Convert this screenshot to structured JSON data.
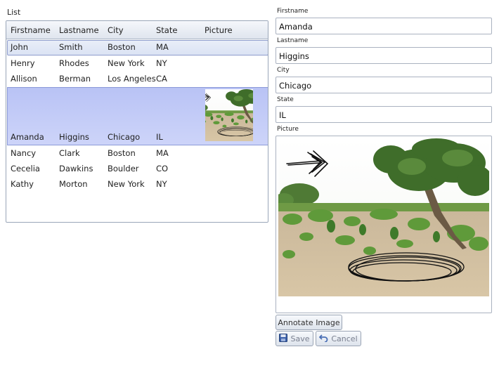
{
  "list": {
    "title": "List",
    "columns": [
      "Firstname",
      "Lastname",
      "City",
      "State",
      "Picture"
    ],
    "rows": [
      {
        "firstname": "John",
        "lastname": "Smith",
        "city": "Boston",
        "state": "MA"
      },
      {
        "firstname": "Henry",
        "lastname": "Rhodes",
        "city": "New York",
        "state": "NY"
      },
      {
        "firstname": "Allison",
        "lastname": "Berman",
        "city": "Los Angeles",
        "state": "CA"
      },
      {
        "firstname": "Amanda",
        "lastname": "Higgins",
        "city": "Chicago",
        "state": "IL"
      },
      {
        "firstname": "Nancy",
        "lastname": "Clark",
        "city": "Boston",
        "state": "MA"
      },
      {
        "firstname": "Cecelia",
        "lastname": "Dawkins",
        "city": "Boulder",
        "state": "CO"
      },
      {
        "firstname": "Kathy",
        "lastname": "Morton",
        "city": "New York",
        "state": "NY"
      }
    ]
  },
  "form": {
    "firstname_label": "Firstname",
    "firstname_value": "Amanda",
    "lastname_label": "Lastname",
    "lastname_value": "Higgins",
    "city_label": "City",
    "city_value": "Chicago",
    "state_label": "State",
    "state_value": "IL",
    "picture_label": "Picture"
  },
  "buttons": {
    "annotate": "Annotate Image",
    "save": "Save",
    "cancel": "Cancel"
  },
  "colors": {
    "selected_row": "#c3cbf7",
    "hover_row": "#e1e7f5",
    "border": "#9aa6b8"
  }
}
